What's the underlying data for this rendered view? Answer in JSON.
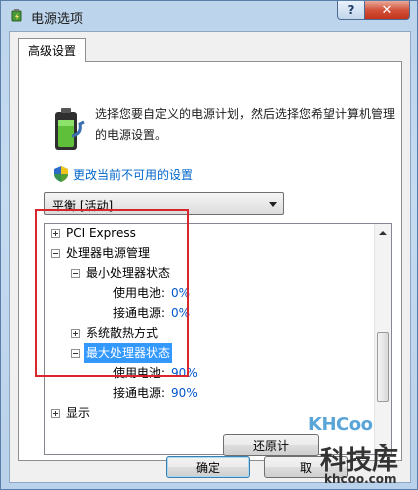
{
  "window": {
    "title": "电源选项",
    "help_label": "?",
    "close_label": "✕"
  },
  "tab": {
    "label": "高级设置"
  },
  "intro": {
    "text": "选择您要自定义的电源计划，然后选择您希望计算机管理的电源设置。",
    "link": "更改当前不可用的设置"
  },
  "plan_select": {
    "value": "平衡 [活动]"
  },
  "tree": {
    "rows": [
      {
        "label": "PCI Express",
        "value": "",
        "expander": "plus"
      },
      {
        "label": "处理器电源管理",
        "value": "",
        "expander": "minus"
      },
      {
        "label": "最小处理器状态",
        "value": "",
        "expander": "minus"
      },
      {
        "label": "使用电池:",
        "value": "0%",
        "expander": ""
      },
      {
        "label": "接通电源:",
        "value": "0%",
        "expander": ""
      },
      {
        "label": "系统散热方式",
        "value": "",
        "expander": "plus"
      },
      {
        "label": "最大处理器状态",
        "value": "",
        "expander": "minus",
        "selected": true
      },
      {
        "label": "使用电池:",
        "value": "90%",
        "expander": ""
      },
      {
        "label": "接通电源:",
        "value": "90%",
        "expander": ""
      },
      {
        "label": "显示",
        "value": "",
        "expander": "plus"
      }
    ]
  },
  "buttons": {
    "restore": "还原计",
    "ok": "确定",
    "cancel": "取"
  },
  "watermark": {
    "logo": "KHCoo",
    "brand": "科技库",
    "domain": "khcoo.com"
  },
  "colors": {
    "highlight": "#d8262d",
    "selection": "#3399ff",
    "link": "#0066cc",
    "value_text": "#0055cc"
  }
}
